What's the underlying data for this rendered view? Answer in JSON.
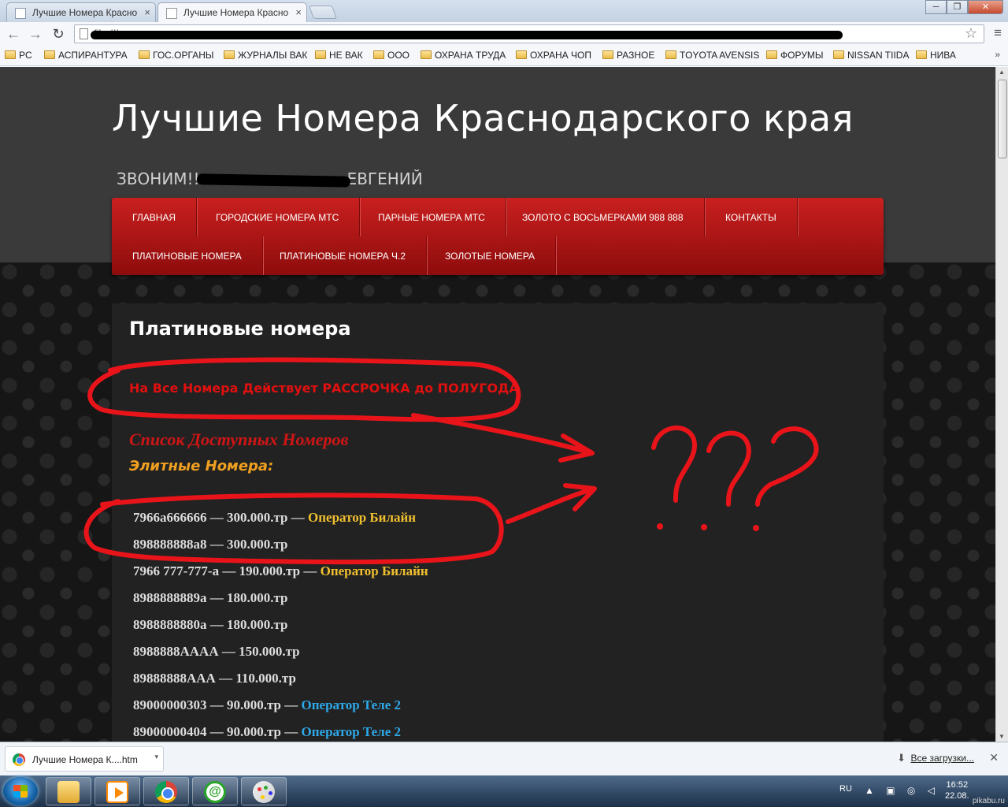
{
  "browser": {
    "tabs": [
      {
        "title": "Лучшие Номера Красно"
      },
      {
        "title": "Лучшие Номера Красно"
      }
    ],
    "tab_close": "×",
    "window_buttons": {
      "minimize": "─",
      "restore": "❐",
      "close": "✕"
    },
    "nav": {
      "back": "←",
      "forward": "→",
      "reload": "↻"
    },
    "url_visible": "file:///",
    "star": "☆",
    "menu_icon": "≡",
    "bookmarks": [
      "PC",
      "АСПИРАНТУРА",
      "ГОС.ОРГАНЫ",
      "ЖУРНАЛЫ ВАК",
      "НЕ ВАК",
      "ООО",
      "ОХРАНА ТРУДА",
      "ОХРАНА ЧОП",
      "РАЗНОЕ",
      "TOYOTA AVENSIS",
      "ФОРУМЫ",
      "NISSAN TIIDA",
      "НИВА"
    ],
    "bookmarks_more": "»"
  },
  "site": {
    "title": "Лучшие Номера Краснодарского края",
    "tagline_prefix": "ЗВОНИМ!!",
    "tagline_suffix": "ЕВГЕНИЙ",
    "menu": [
      "ГЛАВНАЯ",
      "ГОРОДСКИЕ НОМЕРА МТС",
      "ПАРНЫЕ НОМЕРА МТС",
      "ЗОЛОТО С ВОСЬМЕРКАМИ 988 888",
      "КОНТАКТЫ",
      "ПЛАТИНОВЫЕ НОМЕРА",
      "ПЛАТИНОВЫЕ НОМЕРА Ч.2",
      "ЗОЛОТЫЕ НОМЕРА"
    ]
  },
  "content": {
    "title": "Платиновые номера",
    "notice": "На Все Номера Действует РАССРОЧКА до ПОЛУГОДА",
    "list_heading": "Список Доступных Номеров",
    "elite_heading": "Элитные Номера:",
    "numbers": [
      {
        "number": "7966а666666",
        "price": "300.000.тр",
        "operator": "Оператор Билайн",
        "op_class": "op-beeline"
      },
      {
        "number": "898888888а8",
        "price": "300.000.тр",
        "operator": "",
        "op_class": ""
      },
      {
        "number": "7966 777-777-а",
        "price": "190.000.тр",
        "operator": "Оператор Билайн",
        "op_class": "op-beeline"
      },
      {
        "number": "8988888889а",
        "price": "180.000.тр",
        "operator": "",
        "op_class": ""
      },
      {
        "number": "8988888880а",
        "price": "180.000.тр",
        "operator": "",
        "op_class": ""
      },
      {
        "number": "8988888АААА",
        "price": "150.000.тр",
        "operator": "",
        "op_class": ""
      },
      {
        "number": "89888888ААА",
        "price": "110.000.тр",
        "operator": "",
        "op_class": ""
      },
      {
        "number": "89000000303",
        "price": "90.000.тр",
        "operator": "Оператор Теле 2",
        "op_class": "op-tele2"
      },
      {
        "number": "89000000404",
        "price": "90.000.тр",
        "operator": "Оператор Теле 2",
        "op_class": "op-tele2"
      }
    ],
    "dash": "—"
  },
  "annotation": {
    "text": "???",
    "color": "#e8141a"
  },
  "downloads": {
    "file": "Лучшие Номера К....htm",
    "caret": "▾",
    "all": "Все загрузки...",
    "all_icon": "⬇",
    "close": "✕"
  },
  "taskbar": {
    "lang": "RU",
    "tray_icons": "▲ ▣ ◎ ◁",
    "time": "16:52",
    "date": "22.08.",
    "watermark": "pikabu.ru"
  },
  "colors": {
    "menu_red": "#c8201f",
    "notice_red": "#e01010",
    "beeline": "#f0c030",
    "tele2": "#2ea8e8",
    "elite_orange": "#f0a020"
  }
}
